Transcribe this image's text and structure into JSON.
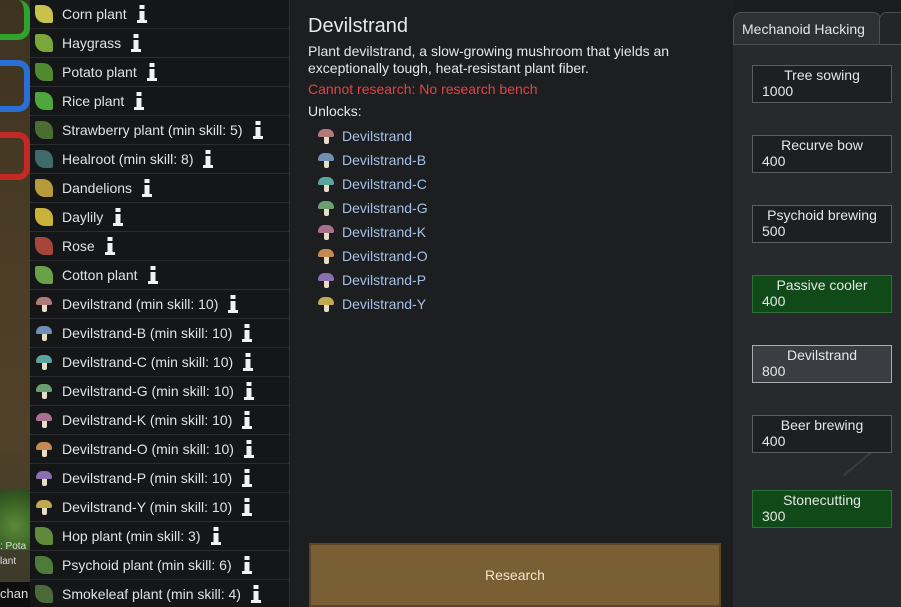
{
  "world": {
    "label_lines": [
      ": Pota",
      "lant"
    ],
    "bottom_text": "chan"
  },
  "plants": [
    {
      "label": "Corn plant",
      "icon": "corn-icon",
      "color": "#c9c24a"
    },
    {
      "label": "Haygrass",
      "icon": "haygrass-icon",
      "color": "#7aa63a"
    },
    {
      "label": "Potato plant",
      "icon": "potato-icon",
      "color": "#4f8a2f"
    },
    {
      "label": "Rice plant",
      "icon": "rice-icon",
      "color": "#4fa63a"
    },
    {
      "label": "Strawberry plant (min skill: 5)",
      "icon": "strawberry-icon",
      "color": "#4a6e2f"
    },
    {
      "label": "Healroot (min skill: 8)",
      "icon": "healroot-icon",
      "color": "#3f6a6a"
    },
    {
      "label": "Dandelions",
      "icon": "dandelion-icon",
      "color": "#b79a3a"
    },
    {
      "label": "Daylily",
      "icon": "daylily-icon",
      "color": "#c9b23a"
    },
    {
      "label": "Rose",
      "icon": "rose-icon",
      "color": "#a8453a"
    },
    {
      "label": "Cotton plant",
      "icon": "cotton-icon",
      "color": "#6aa048"
    },
    {
      "label": "Devilstrand (min skill: 10)",
      "icon": "mushroom-icon",
      "color": "#b07a78"
    },
    {
      "label": "Devilstrand-B (min skill: 10)",
      "icon": "mushroom-b-icon",
      "color": "#6f8fb5"
    },
    {
      "label": "Devilstrand-C (min skill: 10)",
      "icon": "mushroom-c-icon",
      "color": "#5aa59d"
    },
    {
      "label": "Devilstrand-G (min skill: 10)",
      "icon": "mushroom-g-icon",
      "color": "#6aa070"
    },
    {
      "label": "Devilstrand-K (min skill: 10)",
      "icon": "mushroom-k-icon",
      "color": "#a8708f"
    },
    {
      "label": "Devilstrand-O (min skill: 10)",
      "icon": "mushroom-o-icon",
      "color": "#c58a4f"
    },
    {
      "label": "Devilstrand-P (min skill: 10)",
      "icon": "mushroom-p-icon",
      "color": "#8a6fb0"
    },
    {
      "label": "Devilstrand-Y (min skill: 10)",
      "icon": "mushroom-y-icon",
      "color": "#c2a94f"
    },
    {
      "label": "Hop plant (min skill: 3)",
      "icon": "hop-icon",
      "color": "#5e8a3a"
    },
    {
      "label": "Psychoid plant (min skill: 6)",
      "icon": "psychoid-icon",
      "color": "#4e7a3a"
    },
    {
      "label": "Smokeleaf plant (min skill: 4)",
      "icon": "smokeleaf-icon",
      "color": "#4a6a3a"
    }
  ],
  "detail": {
    "title": "Devilstrand",
    "description": "Plant devilstrand, a slow-growing mushroom that yields an exceptionally tough, heat-resistant plant fiber.",
    "warning": "Cannot research: No research bench",
    "unlocks_label": "Unlocks:",
    "unlocks": [
      {
        "label": "Devilstrand",
        "icon": "mushroom-icon",
        "color": "#b07a78"
      },
      {
        "label": "Devilstrand-B",
        "icon": "mushroom-b-icon",
        "color": "#6f8fb5"
      },
      {
        "label": "Devilstrand-C",
        "icon": "mushroom-c-icon",
        "color": "#5aa59d"
      },
      {
        "label": "Devilstrand-G",
        "icon": "mushroom-g-icon",
        "color": "#6aa070"
      },
      {
        "label": "Devilstrand-K",
        "icon": "mushroom-k-icon",
        "color": "#a8708f"
      },
      {
        "label": "Devilstrand-O",
        "icon": "mushroom-o-icon",
        "color": "#c58a4f"
      },
      {
        "label": "Devilstrand-P",
        "icon": "mushroom-p-icon",
        "color": "#8a6fb0"
      },
      {
        "label": "Devilstrand-Y",
        "icon": "mushroom-y-icon",
        "color": "#c2a94f"
      }
    ],
    "research_button": "Research"
  },
  "tree": {
    "active_tab": "Mechanoid Hacking",
    "nodes": [
      {
        "name": "Tree sowing",
        "cost": "1000",
        "state": "normal"
      },
      {
        "name": "Recurve bow",
        "cost": "400",
        "state": "normal"
      },
      {
        "name": "Psychoid brewing",
        "cost": "500",
        "state": "normal"
      },
      {
        "name": "Passive cooler",
        "cost": "400",
        "state": "done"
      },
      {
        "name": "Devilstrand",
        "cost": "800",
        "state": "selected"
      },
      {
        "name": "Beer brewing",
        "cost": "400",
        "state": "normal"
      },
      {
        "name": "Stonecutting",
        "cost": "300",
        "state": "done"
      }
    ]
  }
}
